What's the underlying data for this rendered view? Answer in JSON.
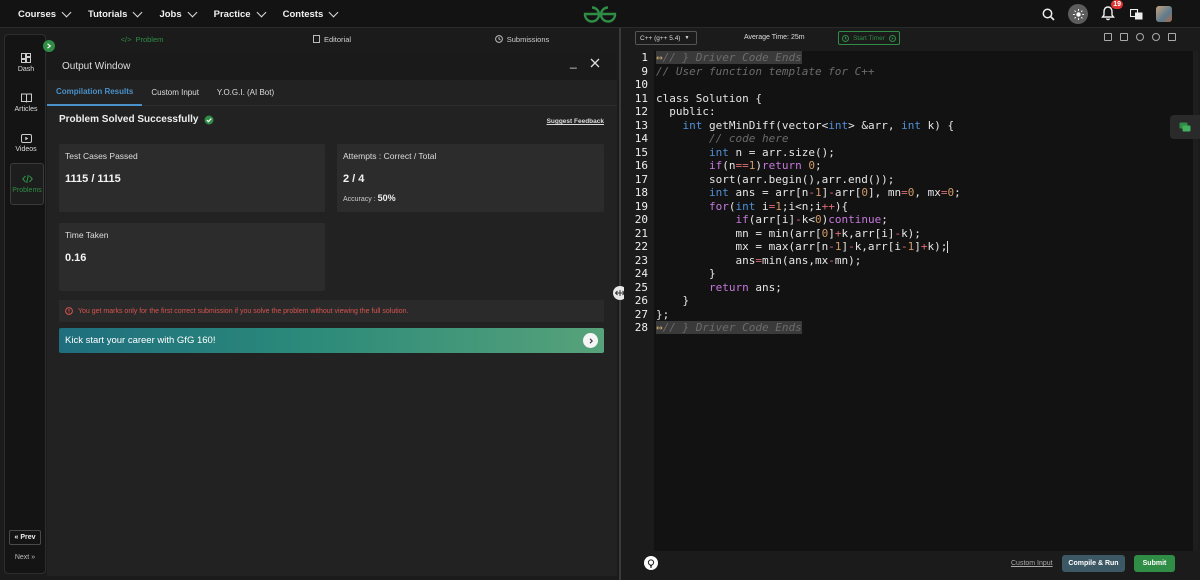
{
  "topbar": {
    "nav": [
      "Courses",
      "Tutorials",
      "Jobs",
      "Practice",
      "Contests"
    ],
    "notification_count": "19"
  },
  "sidebar": {
    "items": [
      "Dash",
      "Articles",
      "Videos",
      "Problems"
    ],
    "prev": "Prev",
    "next": "Next"
  },
  "left_tabs": [
    "Problem",
    "Editorial",
    "Submissions"
  ],
  "output": {
    "title": "Output Window",
    "tabs": [
      "Compilation Results",
      "Custom Input",
      "Y.O.G.I. (AI Bot)"
    ],
    "status": "Problem Solved Successfully",
    "suggest_feedback": "Suggest Feedback",
    "test_cases_label": "Test Cases Passed",
    "test_cases_value": "1115 / 1115",
    "attempts_label": "Attempts : Correct / Total",
    "attempts_value": "2 / 4",
    "accuracy_label": "Accuracy :",
    "accuracy_value": "50%",
    "time_label": "Time Taken",
    "time_value": "0.16",
    "warning": "You get marks only for the first correct submission if you solve the problem without viewing the full solution.",
    "kickstart": "Kick start your career with GfG 160!"
  },
  "editor": {
    "language": "C++ (g++ 5.4)",
    "avg_time": "Average Time: 25m",
    "start_timer": "Start Timer",
    "line_numbers": [
      "1",
      "9",
      "10",
      "11",
      "12",
      "13",
      "14",
      "15",
      "16",
      "17",
      "18",
      "19",
      "20",
      "21",
      "22",
      "23",
      "24",
      "25",
      "26",
      "27",
      "28"
    ],
    "custom_input": "Custom Input",
    "compile_run": "Compile & Run",
    "submit": "Submit"
  },
  "colors": {
    "brand_green": "#2f8d46",
    "tab_blue": "#4a90c9",
    "warning_red": "#d9534f",
    "compile_btn": "#3c5864"
  }
}
